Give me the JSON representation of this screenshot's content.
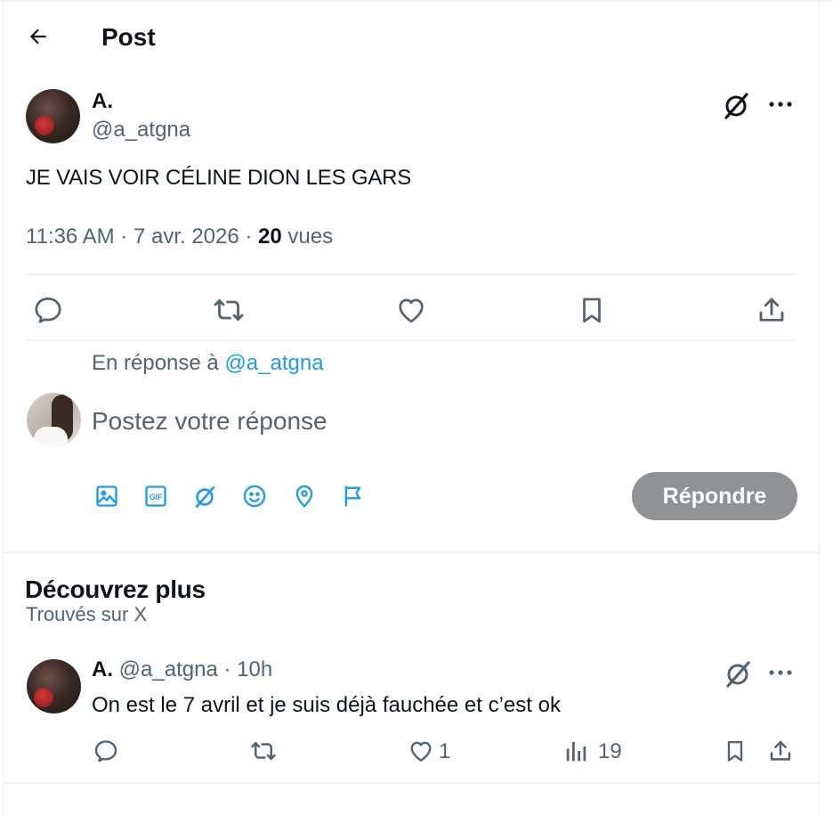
{
  "header": {
    "title": "Post",
    "back_icon": "arrow-left-icon"
  },
  "tweet": {
    "author_name": "A.",
    "author_handle": "@a_atgna",
    "text": "JE VAIS VOIR CÉLINE DION LES GARS",
    "time_date": "11:36 AM · 7 avr. 2026 · ",
    "views_count": "20",
    "views_label": " vues",
    "icons": [
      "grok-icon",
      "more-icon",
      "reply-icon",
      "retweet-icon",
      "like-icon",
      "bookmark-icon",
      "share-icon"
    ]
  },
  "reply_composer": {
    "replying_to_prefix": "En réponse à ",
    "replying_to_handle": "@a_atgna",
    "placeholder": "Postez votre réponse",
    "submit_label": "Répondre",
    "tools": [
      "media-icon",
      "gif-icon",
      "grok-icon",
      "emoji-icon",
      "location-icon",
      "schedule-icon"
    ]
  },
  "discover": {
    "title": "Découvrez plus",
    "subtitle": "Trouvés sur X",
    "items": [
      {
        "author_name": "A.",
        "author_handle": "@a_atgna",
        "separator": " · ",
        "time": "10h",
        "text": "On est le 7 avril et je suis déjà fauchée et c’est ok",
        "like_count": "1",
        "views_count": "19"
      }
    ]
  },
  "colors": {
    "text_primary": "#0f1419",
    "text_secondary": "#536471",
    "accent": "#1d9bf0",
    "button_disabled": "#8f9396",
    "divider": "#eff3f4"
  }
}
